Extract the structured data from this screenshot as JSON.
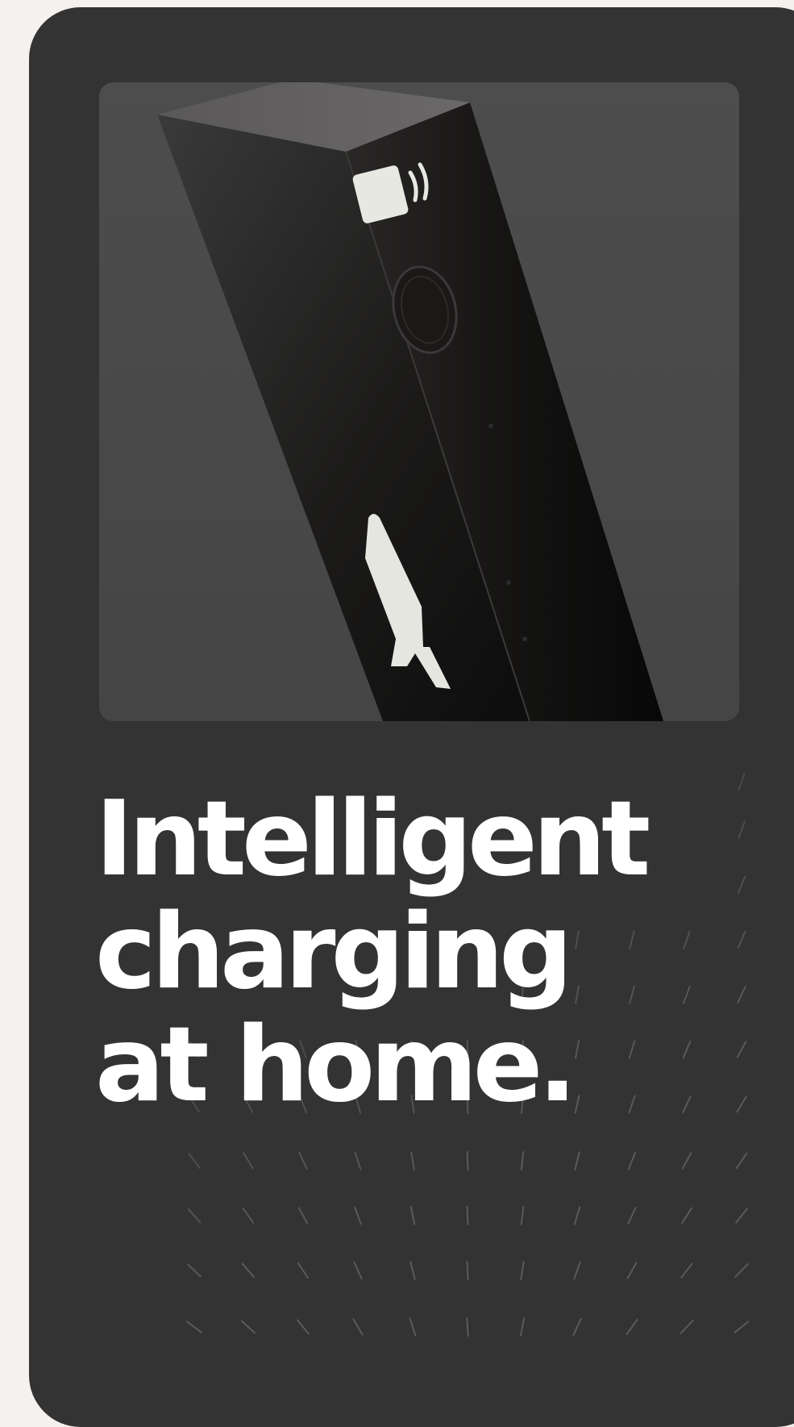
{
  "hero": {
    "headline": "Intelligent\ncharging\nat home.",
    "image_description_icon": "ev-charger-icon"
  },
  "colors": {
    "page_background": "#f4f1ee",
    "card_background": "#333333",
    "image_background": "#4a4a4a",
    "headline_text": "#ffffff"
  }
}
